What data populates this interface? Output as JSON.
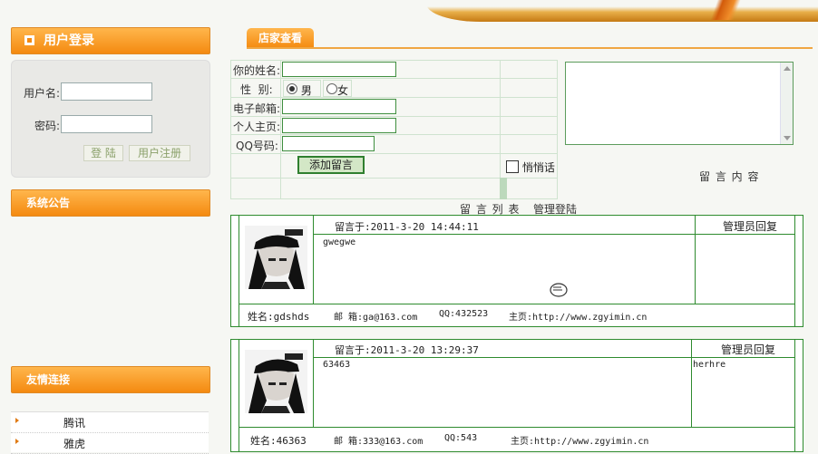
{
  "left": {
    "login_title": "用户登录",
    "username_label": "用户名:",
    "password_label": "密码:",
    "login_button": "登 陆",
    "register_button": "用户注册",
    "notice_title": "系统公告",
    "links_title": "友情连接",
    "links": [
      "腾讯",
      "雅虎"
    ]
  },
  "main": {
    "tab_label": "店家查看",
    "form": {
      "name_label": "你的姓名:",
      "gender_label": "性  别:",
      "male": "男",
      "female": "女",
      "email_label": "电子邮箱:",
      "homepage_label": "个人主页:",
      "qq_label": "QQ号码:",
      "submit_button": "添加留言",
      "whisper_label": "悄悄话",
      "content_label": "留 言 内 容"
    },
    "list_title": "留 言 列 表",
    "admin_login": "管理登陆",
    "messages": [
      {
        "time": "留言于:2011-3-20 14:44:11",
        "reply_header": "管理员回复",
        "body": "gwegwe",
        "reply": "",
        "name": "姓名:gdshds",
        "email": "邮 箱:ga@163.com",
        "qq": "QQ:432523",
        "homepage": "主页:http://www.zgyimin.cn"
      },
      {
        "time": "留言于:2011-3-20 13:29:37",
        "reply_header": "管理员回复",
        "body": "63463",
        "reply": "herhre",
        "name": "姓名:46363",
        "email": "邮 箱:333@163.com",
        "qq": "QQ:543",
        "homepage": "主页:http://www.zgyimin.cn"
      }
    ]
  },
  "colors": {
    "accent_orange": "#f48a10",
    "grid_green": "#2e8b2e"
  }
}
